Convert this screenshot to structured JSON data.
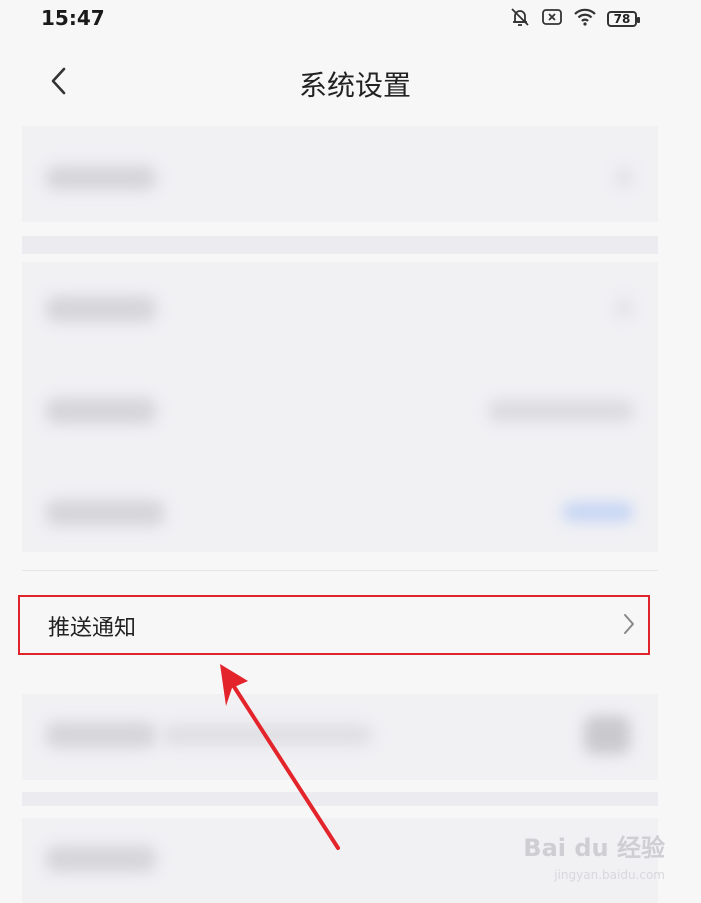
{
  "status_bar": {
    "time": "15:47",
    "battery": "78"
  },
  "header": {
    "title": "系统设置"
  },
  "settings": {
    "push_notification_label": "推送通知"
  },
  "watermark": {
    "brand": "Bai du 经验",
    "url": "jingyan.baidu.com"
  },
  "colors": {
    "highlight": "#e0242c",
    "background": "#f7f7f8"
  }
}
